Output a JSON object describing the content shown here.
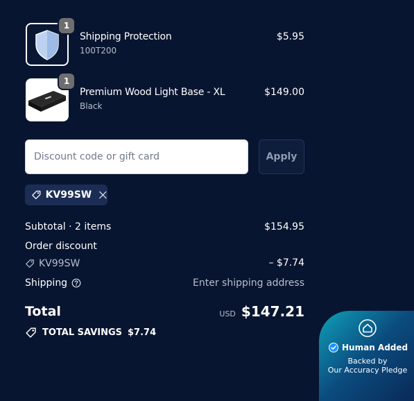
{
  "line_items": [
    {
      "quantity": "1",
      "name": "Shipping Protection",
      "variant": "100T200",
      "price": "$5.95",
      "icon": "shield-icon"
    },
    {
      "quantity": "1",
      "name": "Premium Wood Light Base - XL",
      "variant": "Black",
      "price": "$149.00",
      "icon": "product-image"
    }
  ],
  "discount": {
    "placeholder": "Discount code or gift card",
    "apply_label": "Apply",
    "applied_code": "KV99SW"
  },
  "summary": {
    "subtotal_label": "Subtotal · 2 items",
    "subtotal_value": "$154.95",
    "order_discount_label": "Order discount",
    "discount_code": "KV99SW",
    "discount_value": "– $7.74",
    "shipping_label": "Shipping",
    "shipping_value": "Enter shipping address",
    "total_label": "Total",
    "currency": "USD",
    "total_value": "$147.21",
    "savings_label": "TOTAL SAVINGS",
    "savings_value": "$7.74"
  },
  "badge": {
    "title": "Human Added",
    "line1": "Backed by",
    "line2": "Our Accuracy Pledge"
  },
  "colors": {
    "background": "#081530",
    "chip": "#1c2d55",
    "badge_accent": "#0fa0b8"
  }
}
